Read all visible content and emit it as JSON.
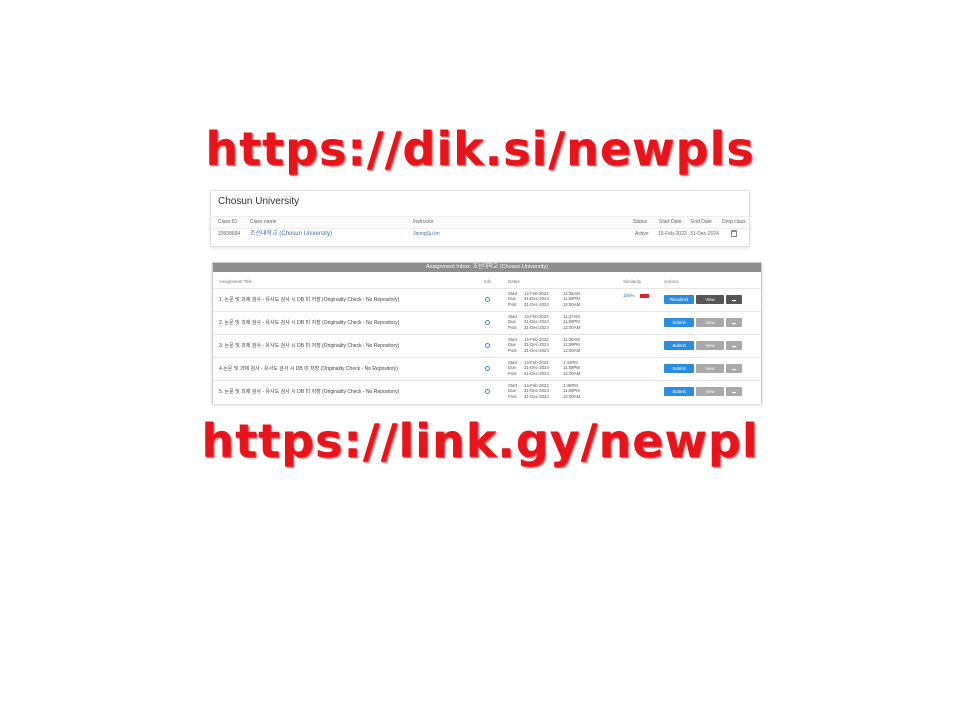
{
  "banners": {
    "top": "https://dik.si/newpls",
    "bottom": "https://link.gy/newpl"
  },
  "class_panel": {
    "title": "Chosun University",
    "headers": [
      "Class ID",
      "Class name",
      "Instructor",
      "Status",
      "Start Date",
      "End Date",
      "Drop class"
    ],
    "row": {
      "class_id": "33608684",
      "class_name": "조선대학교 (Chosun University)",
      "instructor": "JeongSu Im",
      "status": "Active",
      "start_date": "15-Feb-2022",
      "end_date": "31-Dec-2024"
    }
  },
  "assignment_panel": {
    "title": "Assignment Inbox: 조선대학교 (Chosun University)",
    "headers": {
      "title": "Assignment Title",
      "info": "Info",
      "dates": "Dates",
      "similarity": "Similarity",
      "actions": "Actions"
    },
    "date_labels": [
      "Start",
      "Due",
      "Post"
    ],
    "rows": [
      {
        "title": "1. 논문 및 과제 검사 - 유사도 검사 시 DB 미 저장 (Originality Check - No Repository)",
        "dates": [
          "14-Feb-2022",
          "31-Dec-2024",
          "31-Dec-2024"
        ],
        "times": [
          "11:35AM",
          "11:59PM",
          "12:00AM"
        ],
        "similarity": "100%",
        "primary_label": "Resubmit",
        "view_label": "View"
      },
      {
        "title": "2. 논문 및 과제 검사 - 유사도 검사 시 DB 미 저장 (Originality Check - No Repository)",
        "dates": [
          "14-Feb-2022",
          "31-Dec-2024",
          "31-Dec-2024"
        ],
        "times": [
          "11:37AM",
          "11:59PM",
          "12:00AM"
        ],
        "similarity": "",
        "primary_label": "Submit",
        "view_label": "View"
      },
      {
        "title": "3. 논문 및 과제 검사 - 유사도 검사 시 DB 미 저장 (Originality Check - No Repository)",
        "dates": [
          "14-Feb-2022",
          "31-Dec-2024",
          "31-Dec-2024"
        ],
        "times": [
          "11:39AM",
          "11:59PM",
          "12:00AM"
        ],
        "similarity": "",
        "primary_label": "Submit",
        "view_label": "View"
      },
      {
        "title": "4.논문 및 과제 검사 - 유사도 검사 시 DB 미 저장 (Originality Check - No Repository)",
        "dates": [
          "14-Feb-2022",
          "31-Dec-2024",
          "31-Dec-2024"
        ],
        "times": [
          "1:44PM",
          "11:59PM",
          "12:00AM"
        ],
        "similarity": "",
        "primary_label": "Submit",
        "view_label": "View"
      },
      {
        "title": "5. 논문 및 과제 검사 - 유사도 검사 시 DB 미 저장 (Originality Check - No Repository)",
        "dates": [
          "14-Feb-2022",
          "31-Dec-2024",
          "31-Dec-2024"
        ],
        "times": [
          "1:46PM",
          "11:59PM",
          "12:00AM"
        ],
        "similarity": "",
        "primary_label": "Submit",
        "view_label": "View"
      }
    ]
  },
  "colors": {
    "banner_red": "#e8141b",
    "primary_blue": "#2a8de0",
    "similarity_red": "#e0202a"
  },
  "icons": [
    "info-icon",
    "download-icon",
    "trash-icon"
  ]
}
